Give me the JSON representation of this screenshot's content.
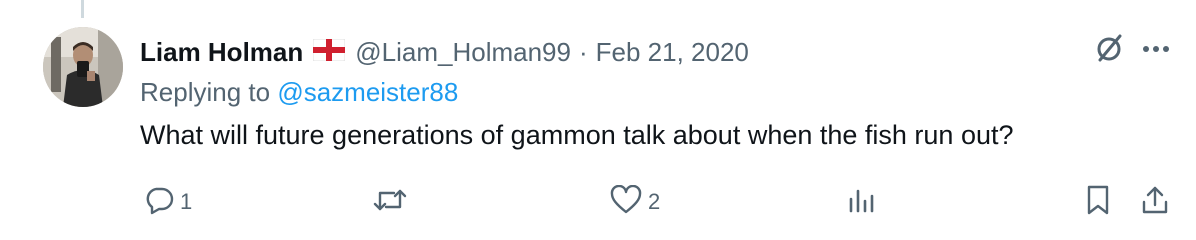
{
  "tweet": {
    "author_name": "Liam Holman",
    "author_handle": "@Liam_Holman99",
    "separator": "·",
    "date": "Feb 21, 2020",
    "replying_prefix": "Replying to",
    "replying_to": "@sazmeister88",
    "text": "What will future generations of gammon talk about when the fish run out?"
  },
  "actions": {
    "reply_count": "1",
    "like_count": "2"
  },
  "icons": {
    "flag": "england-flag-icon",
    "grok": "grok-icon",
    "more": "more-icon",
    "reply": "reply-icon",
    "retweet": "retweet-icon",
    "like": "like-icon",
    "views": "views-icon",
    "bookmark": "bookmark-icon",
    "share": "share-icon"
  },
  "colors": {
    "text_primary": "#0f1419",
    "text_secondary": "#536471",
    "link": "#1d9bf0"
  }
}
